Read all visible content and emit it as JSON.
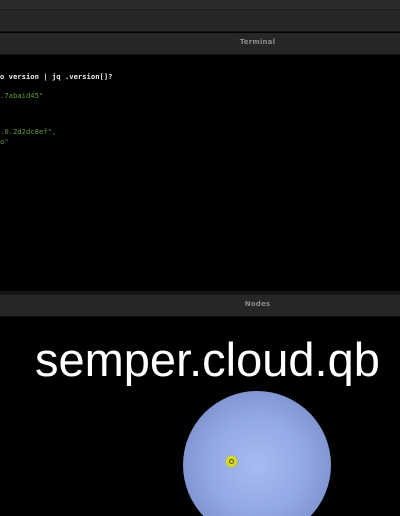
{
  "terminal": {
    "title": "Terminal",
    "lines": [
      {
        "text": "o version | jq .version[]?",
        "kind": "cmd"
      },
      {
        "text": ".7abaid45\"",
        "kind": "str"
      },
      {
        "text": ".0.2d2dc8ef\",",
        "kind": "str"
      },
      {
        "text": "o\"",
        "kind": "str"
      }
    ]
  },
  "nodes": {
    "title": "Nodes",
    "node_label": "semper.cloud.qb"
  },
  "colors": {
    "background": "#000000",
    "header": "#262626",
    "string_green": "#5f9a3a",
    "node_blue": "#93a9e4",
    "cursor_yellow": "#d9d92a"
  }
}
